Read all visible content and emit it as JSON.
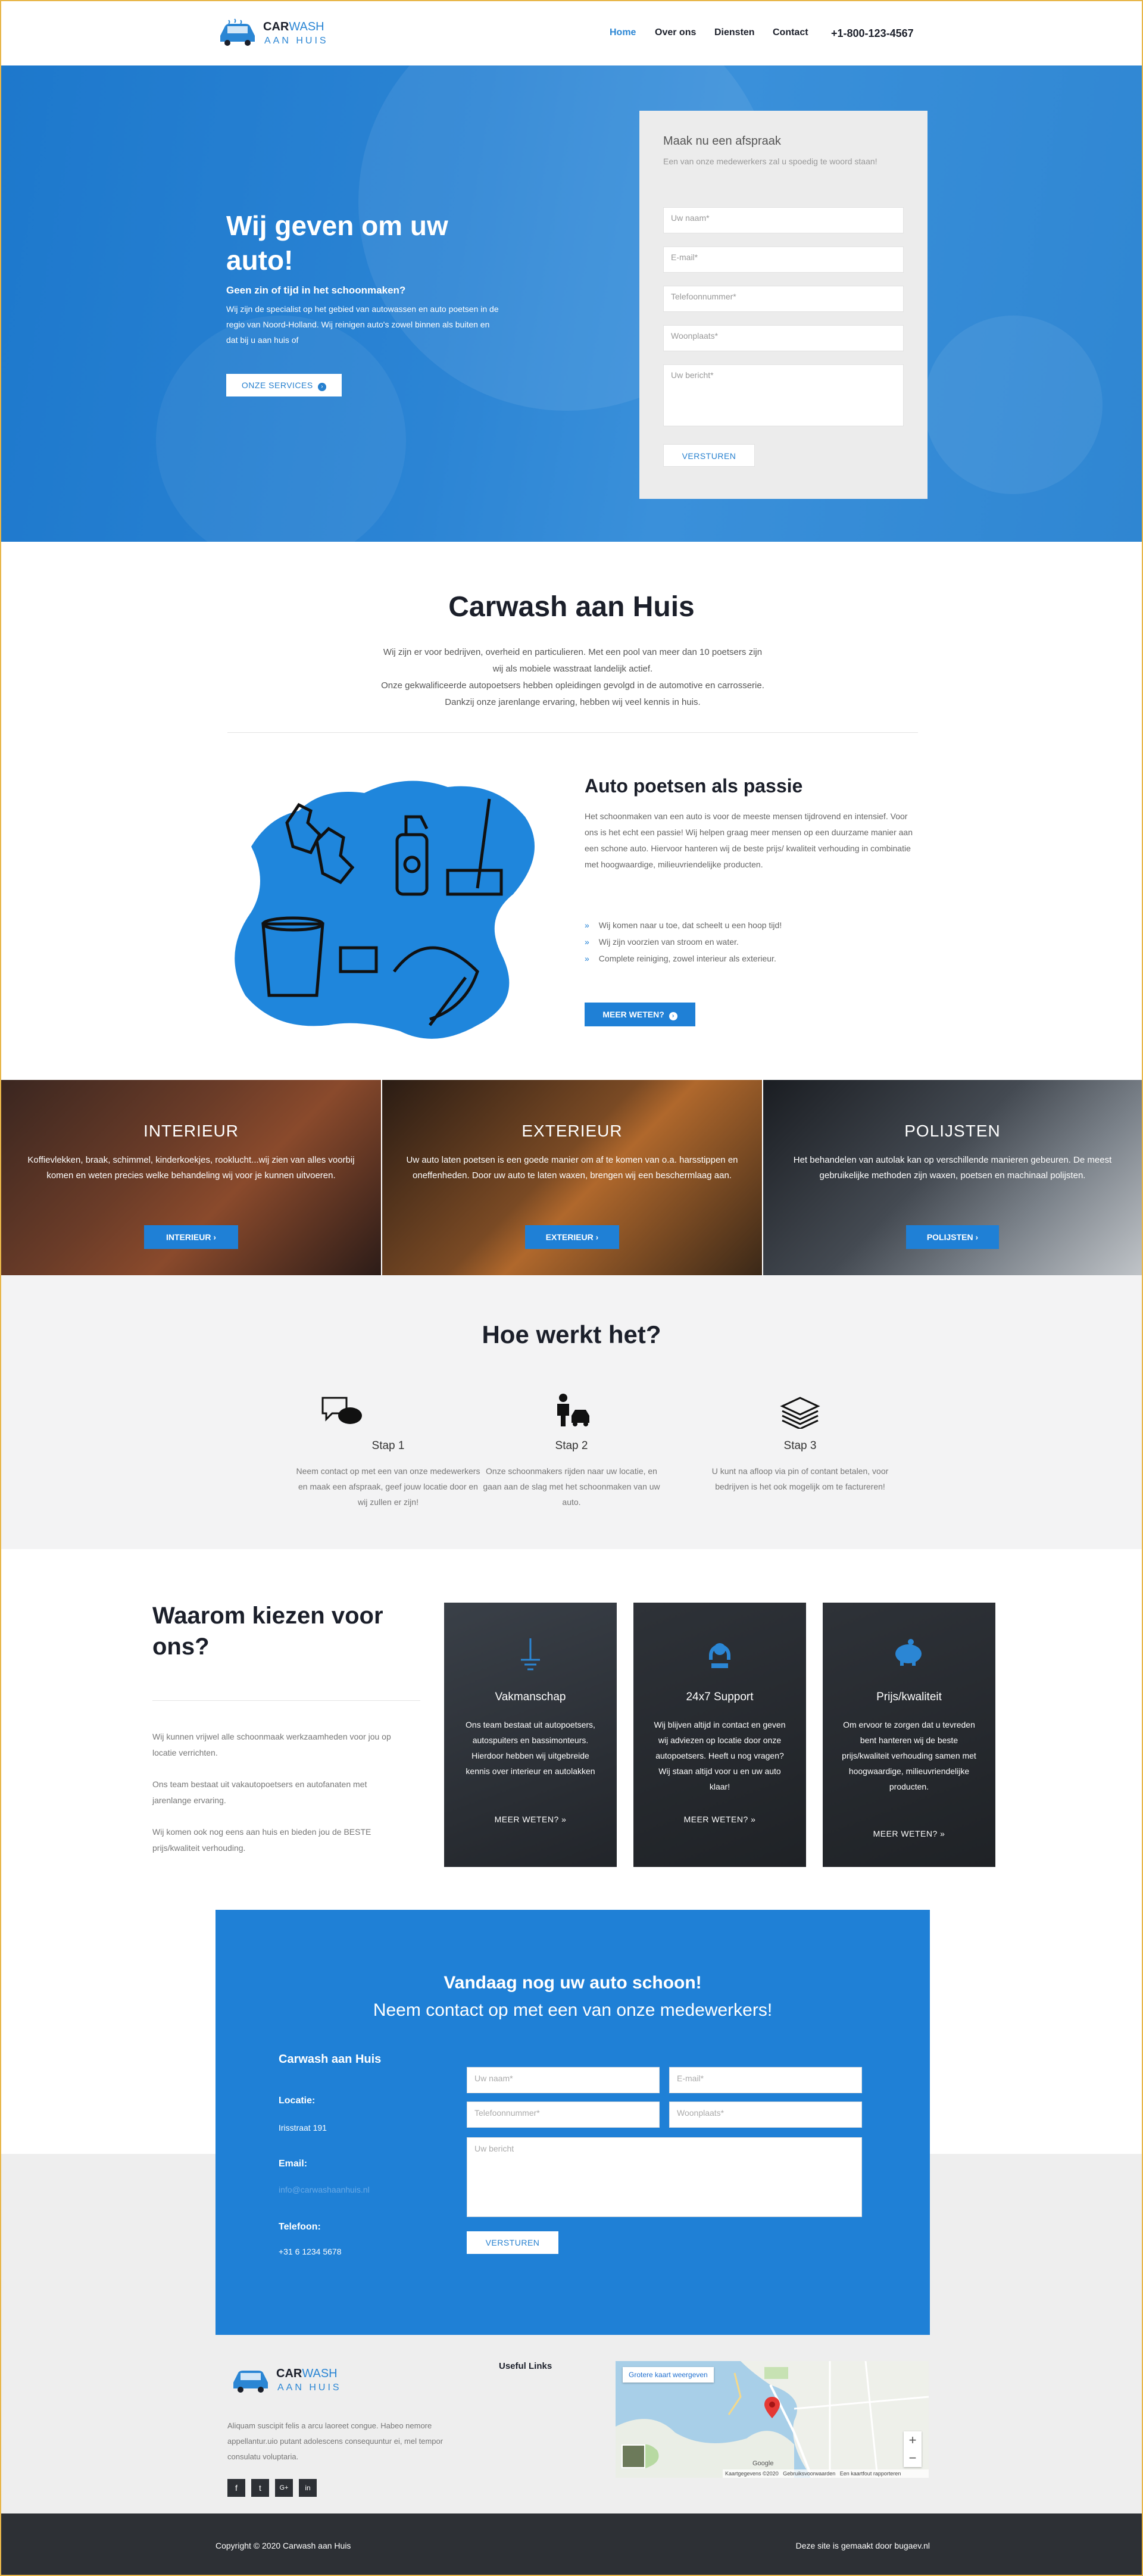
{
  "header": {
    "logo": {
      "car": "CAR",
      "wash": "WASH",
      "sub": "AAN HUIS"
    },
    "nav": [
      "Home",
      "Over ons",
      "Diensten",
      "Contact"
    ],
    "phone": "+1-800-123-4567"
  },
  "hero": {
    "title": "Wij geven om uw auto!",
    "subtitle": "Geen zin of tijd in het schoonmaken?",
    "text": "Wij zijn de specialist op het gebied van autowassen en auto poetsen in de regio van Noord-Holland. Wij reinigen auto's zowel binnen als buiten en dat bij u aan huis of",
    "button": "ONZE SERVICES"
  },
  "appointment": {
    "title": "Maak nu een afspraak",
    "subtitle": "Een van onze medewerkers zal u spoedig te woord staan!",
    "placeholders": [
      "Uw naam*",
      "E-mail*",
      "Telefoonnummer*",
      "Woonplaats*",
      "Uw bericht*"
    ],
    "button": "VERSTUREN"
  },
  "about": {
    "title": "Carwash aan Huis",
    "lines": [
      "Wij zijn er voor bedrijven, overheid en particulieren. Met een pool van meer dan 10 poetsers zijn",
      "wij als mobiele wasstraat landelijk actief.",
      "Onze gekwalificeerde autopoetsers hebben opleidingen gevolgd in de automotive en carrosserie.",
      "Dankzij onze jarenlange ervaring, hebben wij veel kennis in huis."
    ]
  },
  "passion": {
    "title": "Auto poetsen als passie",
    "text": "Het schoonmaken van een auto is voor de meeste mensen tijdrovend en intensief. Voor ons is het echt een passie! Wij helpen graag meer mensen op een duurzame manier aan een schone auto. Hiervoor hanteren wij de beste prijs/ kwaliteit verhouding in combinatie met hoogwaardige, milieuvriendelijke producten.",
    "bullets": [
      "Wij komen naar u toe, dat scheelt u een hoop tijd!",
      "Wij zijn voorzien van stroom en water.",
      "Complete reiniging, zowel interieur als exterieur."
    ],
    "button": "MEER WETEN?"
  },
  "services": [
    {
      "title": "INTERIEUR",
      "text": "Koffievlekken, braak, schimmel, kinderkoekjes, rooklucht...wij zien van alles voorbij komen en weten precies welke behandeling wij voor je kunnen uitvoeren.",
      "button": "INTERIEUR"
    },
    {
      "title": "EXTERIEUR",
      "text": "Uw auto laten poetsen is een goede manier om af te komen van o.a. harsstippen en oneffenheden. Door uw auto te laten waxen, brengen wij een beschermlaag aan.",
      "button": "EXTERIEUR"
    },
    {
      "title": "POLIJSTEN",
      "text": "Het behandelen van autolak kan op verschillende manieren gebeuren. De meest gebruikelijke methoden zijn waxen, poetsen en machinaal polijsten.",
      "button": "POLIJSTEN"
    }
  ],
  "how": {
    "title": "Hoe werkt het?",
    "steps": [
      {
        "title": "Stap 1",
        "text": "Neem contact op met een van onze medewerkers en maak een afspraak, geef jouw locatie door en wij zullen er zijn!"
      },
      {
        "title": "Stap 2",
        "text": "Onze schoonmakers rijden naar uw locatie, en gaan aan de slag met het schoonmaken van uw auto."
      },
      {
        "title": "Stap 3",
        "text": "U kunt na afloop via pin of contant betalen, voor bedrijven is het ook mogelijk om te factureren!"
      }
    ]
  },
  "why": {
    "title": "Waarom kiezen voor ons?",
    "paragraphs": [
      "Wij kunnen vrijwel alle schoonmaak werkzaamheden voor jou op locatie verrichten.",
      "Ons team bestaat uit vakautopoetsers en autofanaten met jarenlange ervaring.",
      "Wij komen ook nog eens aan huis en bieden jou de BESTE prijs/kwaliteit verhouding."
    ],
    "cards": [
      {
        "title": "Vakmanschap",
        "text": "Ons team bestaat uit autopoetsers, autospuiters en bassimonteurs. Hierdoor hebben wij uitgebreide kennis over interieur en autolakken",
        "link": "MEER WETEN?"
      },
      {
        "title": "24x7 Support",
        "text": "Wij blijven altijd in contact en geven wij adviezen op locatie door onze autopoetsers. Heeft u nog vragen? Wij staan altijd voor u en uw auto klaar!",
        "link": "MEER WETEN?"
      },
      {
        "title": "Prijs/kwaliteit",
        "text": "Om ervoor te zorgen dat u tevreden bent hanteren wij de beste prijs/kwaliteit verhouding samen met hoogwaardige, milieuvriendelijke producten.",
        "link": "MEER WETEN?"
      }
    ]
  },
  "contact": {
    "title1": "Vandaag nog uw auto schoon!",
    "title2": "Neem contact op met een van onze medewerkers!",
    "company": "Carwash aan Huis",
    "location_label": "Locatie:",
    "location": "Irisstraat 191",
    "email_label": "Email:",
    "email": "info@carwashaanhuis.nl",
    "phone_label": "Telefoon:",
    "phone": "+31 6 1234 5678",
    "placeholders": [
      "Uw naam*",
      "E-mail*",
      "Telefoonnummer*",
      "Woonplaats*",
      "Uw bericht"
    ],
    "button": "VERSTUREN"
  },
  "footer": {
    "text": "Aliquam suscipit felis a arcu laoreet congue. Habeo nemore appellantur.uio putant adolescens consequuntur ei, mel tempor consulatu voluptaria.",
    "useful_links": "Useful Links",
    "map_button": "Grotere kaart weergeven",
    "map_attrib": [
      "Kaartgegevens ©2020",
      "Gebruiksvoorwaarden",
      "Een kaartfout rapporteren"
    ],
    "map_logo": "Google",
    "social": [
      "f",
      "t",
      "G+",
      "in"
    ],
    "copyright": "Copyright © 2020 Carwash aan Huis",
    "credit": "Deze site is gemaakt door bugaev.nl"
  },
  "colors": {
    "primary": "#1f80d6",
    "dark": "#2d3035",
    "heading": "#1b1f2a"
  }
}
